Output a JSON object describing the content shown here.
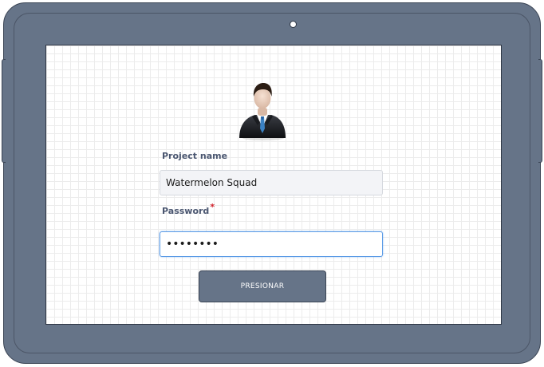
{
  "form": {
    "project_label": "Project name",
    "project_value": "Watermelon Squad",
    "password_label": "Password",
    "password_required_mark": "*",
    "password_value": "••••••••",
    "submit_label": "PRESIONAR"
  },
  "icons": {
    "avatar": "businessman-avatar-icon",
    "camera": "camera-dot"
  },
  "colors": {
    "device_frame": "#667488",
    "button_bg": "#667488",
    "label_text": "#4a5670",
    "required_mark": "#d0202a",
    "focus_border": "#5b9be6"
  }
}
